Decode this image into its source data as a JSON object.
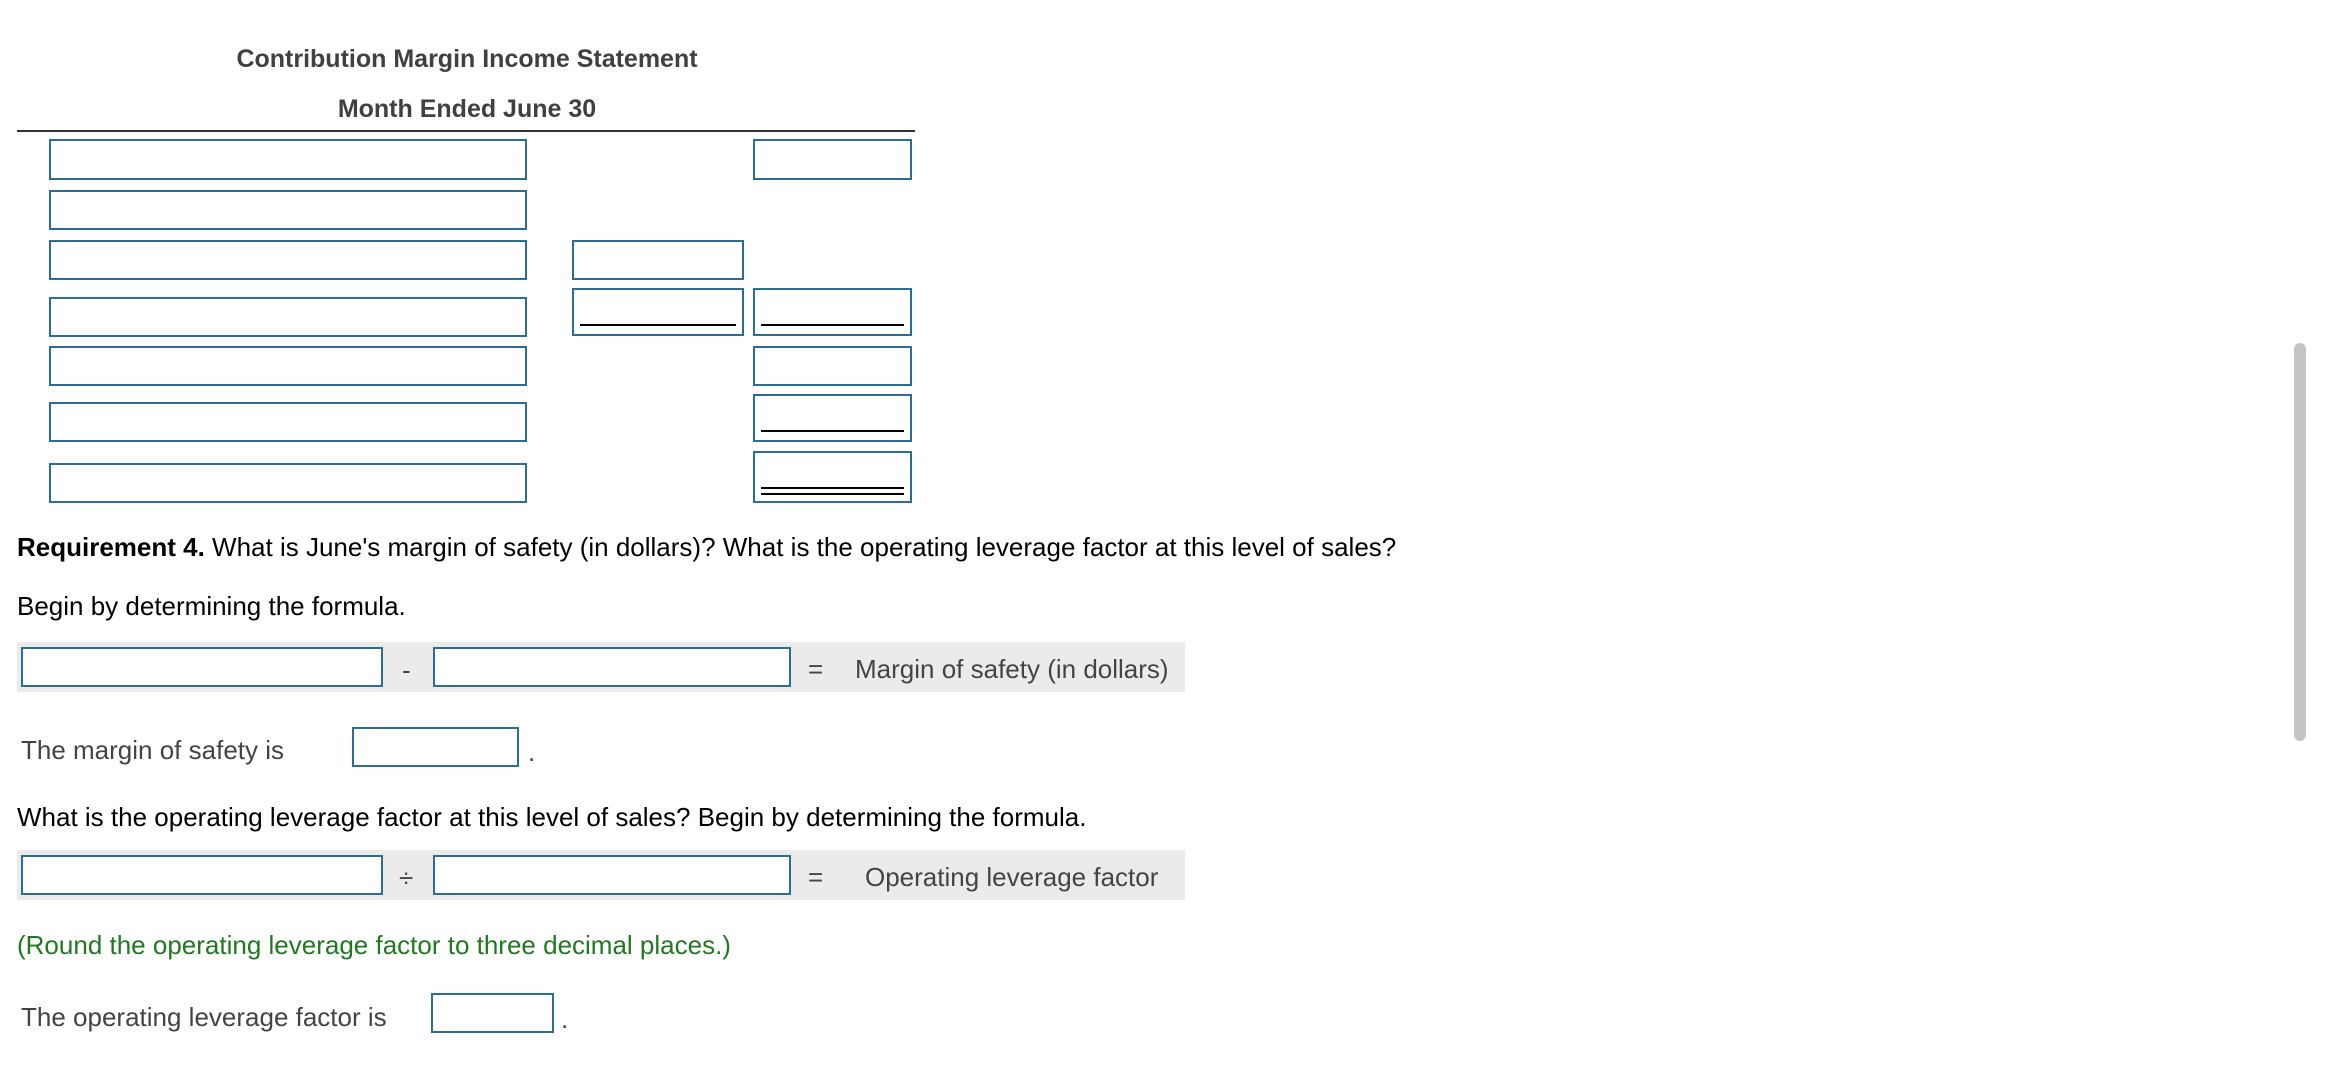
{
  "statement": {
    "title": "Contribution Margin Income Statement",
    "period": "Month Ended June 30"
  },
  "requirement4": {
    "label": "Requirement 4.",
    "question": " What is June's margin of safety (in dollars)? What is the operating leverage factor at this level of sales?",
    "instruction": "Begin by determining the formula."
  },
  "margin_formula": {
    "operator": "-",
    "equals": "=",
    "result_label": "Margin of safety (in dollars)"
  },
  "margin_answer": {
    "label": "The margin of safety is",
    "period": "."
  },
  "leverage_question": "What is the operating leverage factor at this level of sales? Begin by determining the formula.",
  "leverage_formula": {
    "operator": "÷",
    "equals": "=",
    "result_label": "Operating leverage factor"
  },
  "rounding_note": "(Round the operating leverage factor to three decimal places.)",
  "leverage_answer": {
    "label": "The operating leverage factor is",
    "period": "."
  }
}
